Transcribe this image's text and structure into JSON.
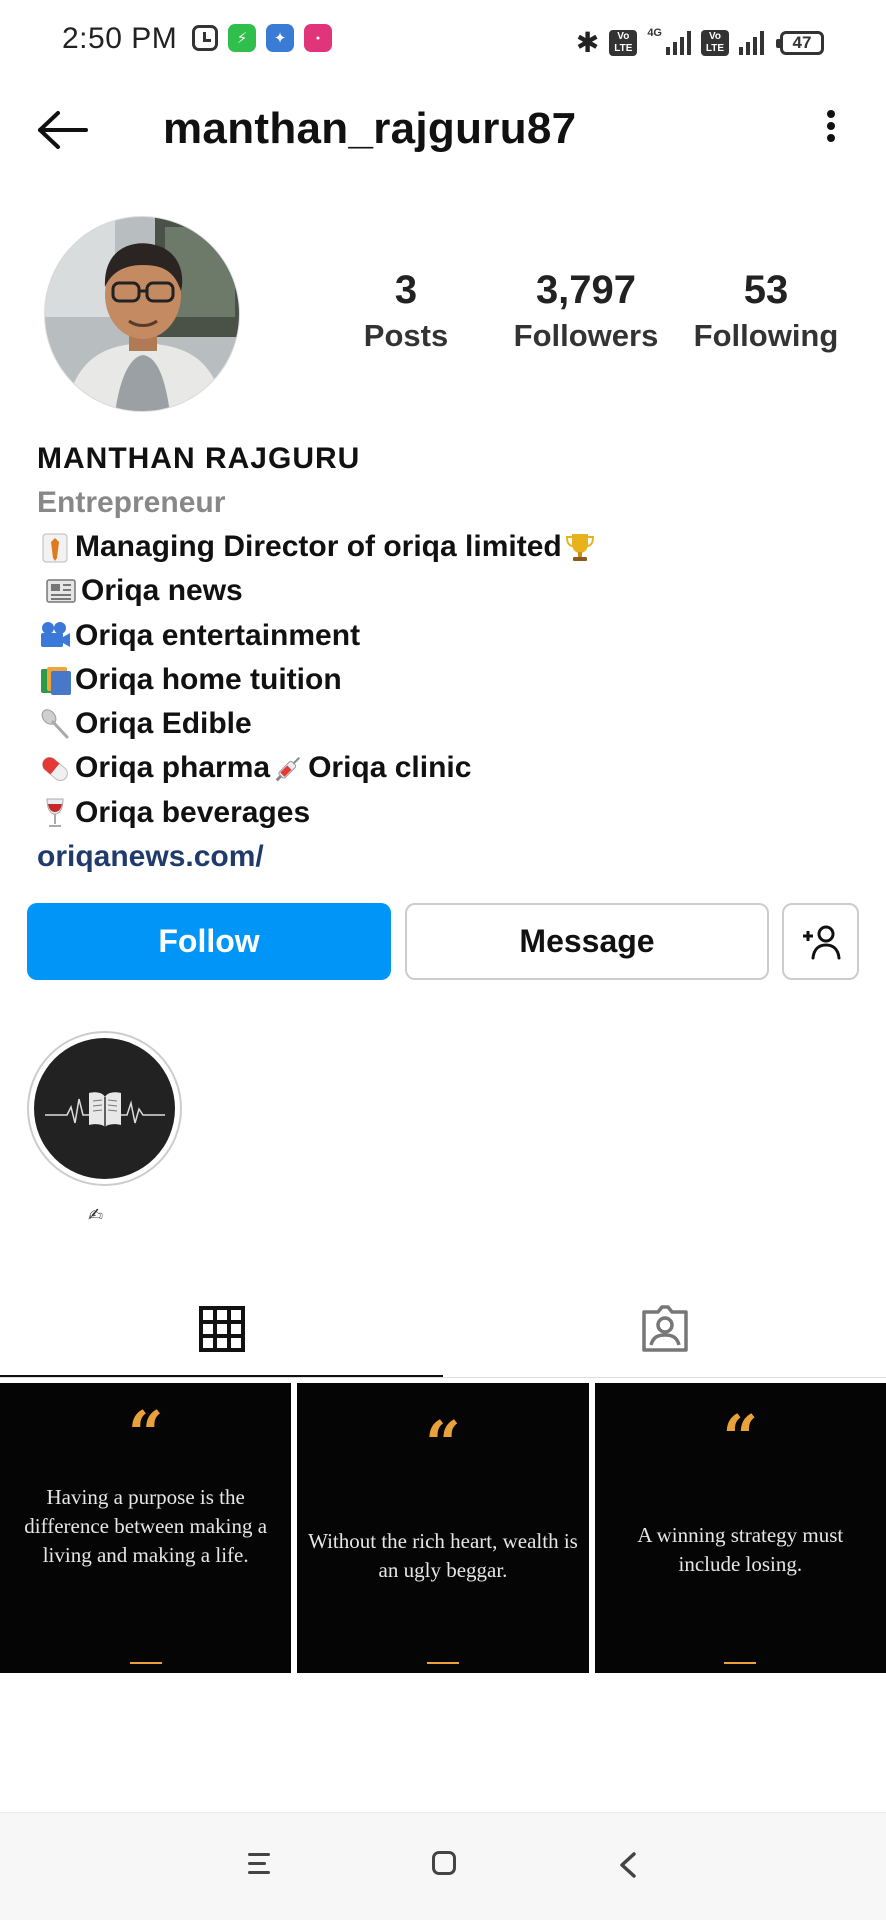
{
  "status_bar": {
    "time": "2:50 PM",
    "battery": "47",
    "network": "4G",
    "volte": "Vo LTE"
  },
  "header": {
    "username": "manthan_rajguru87"
  },
  "stats": [
    {
      "value": "3",
      "label": "Posts"
    },
    {
      "value": "3,797",
      "label": "Followers"
    },
    {
      "value": "53",
      "label": "Following"
    }
  ],
  "bio": {
    "name": "MANTHAN RAJGURU",
    "category": "Entrepreneur",
    "lines": [
      "Managing Director of oriqa limited",
      "Oriqa news",
      "Oriqa entertainment",
      "Oriqa home tuition",
      "Oriqa Edible",
      "Oriqa pharma",
      "Oriqa clinic",
      "Oriqa beverages"
    ],
    "link": "oriqanews.com/"
  },
  "buttons": {
    "follow": "Follow",
    "message": "Message"
  },
  "highlight": {
    "label": "✍"
  },
  "posts": [
    {
      "quote_mark": "“",
      "text": "Having a purpose is the difference between making a living and making a life."
    },
    {
      "quote_mark": "“",
      "text": "Without the rich heart, wealth is an ugly beggar."
    },
    {
      "quote_mark": "“",
      "text": "A winning strategy must include losing."
    }
  ],
  "colors": {
    "follow_button": "#0095f6",
    "link": "#1f3a6b",
    "quote_accent": "#e9a23b"
  }
}
